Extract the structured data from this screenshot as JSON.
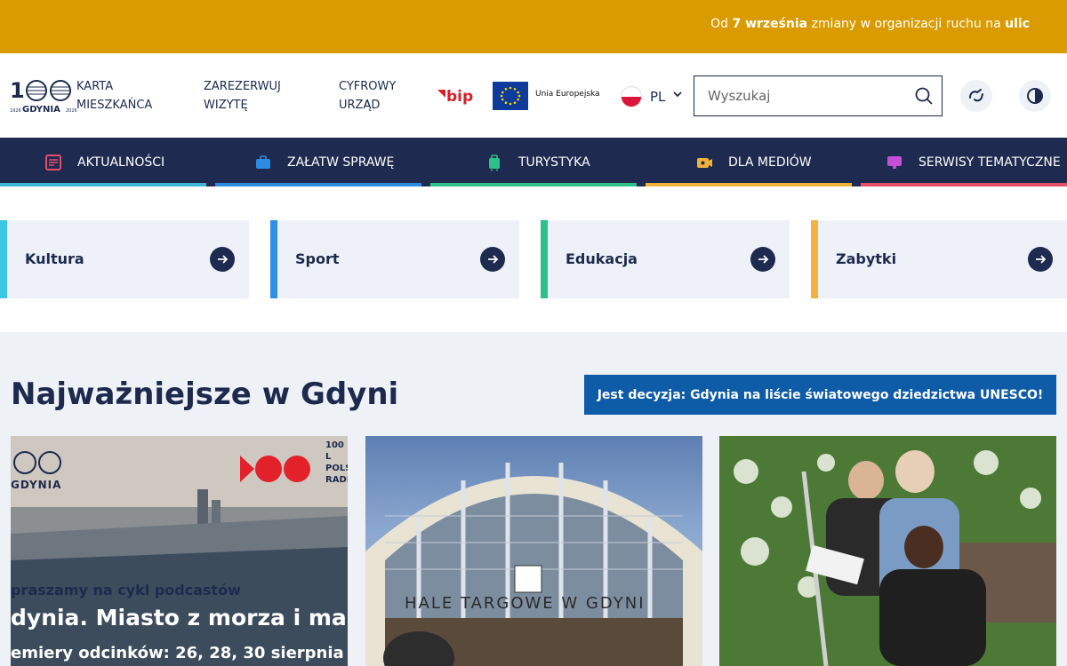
{
  "banner": {
    "text_prefix": "Od ",
    "text_bold1": "7 września",
    "text_middle": " zmiany w organizacji ruchu na ",
    "text_bold2": "ulic"
  },
  "header": {
    "logo_text": "GDYNIA",
    "logo_year_left": "1926",
    "logo_year_right": "2026",
    "links": [
      {
        "line1": "KARTA",
        "line2": "MIESZKAŃCA"
      },
      {
        "line1": "ZAREZERWUJ",
        "line2": "WIZYTĘ"
      },
      {
        "line1": "CYFROWY",
        "line2": "URZĄD"
      }
    ],
    "bip_label": "bip",
    "eu_label": "Unia Europejska",
    "lang": "PL",
    "search_placeholder": "Wyszukaj"
  },
  "nav": [
    {
      "label": "AKTUALNOŚCI",
      "icon": "newspaper-icon",
      "color": "#3cb4d8"
    },
    {
      "label": "ZAŁATW SPRAWĘ",
      "icon": "briefcase-icon",
      "color": "#2f8be0"
    },
    {
      "label": "TURYSTYKA",
      "icon": "luggage-icon",
      "color": "#2fbf8a"
    },
    {
      "label": "DLA MEDIÓW",
      "icon": "camera-icon",
      "color": "#f0b138"
    },
    {
      "label": "SERWISY TEMATYCZNE",
      "icon": "monitor-icon",
      "color": "#e64e6b"
    }
  ],
  "tiles": [
    {
      "label": "Kultura",
      "color": "#3cc6e3"
    },
    {
      "label": "Sport",
      "color": "#2f8fe8"
    },
    {
      "label": "Edukacja",
      "color": "#2fc18a"
    },
    {
      "label": "Zabytki",
      "color": "#f3b33d"
    }
  ],
  "highlights": {
    "title": "Najważniejsze w Gdyni",
    "featured_button": "Jest decyzja: Gdynia na liście światowego dziedzictwa UNESCO!",
    "card1": {
      "logo_text": "GDYNIA",
      "radio_text": "100 L POLS RADI",
      "line1": "praszamy na cykl podcastów",
      "line2": "dynia. Miasto z morza i marze",
      "line3": "emiery odcinków: 26, 28, 30 sierpnia"
    },
    "card2": {
      "sign": "HALE TARGOWE W GDYNI"
    }
  }
}
